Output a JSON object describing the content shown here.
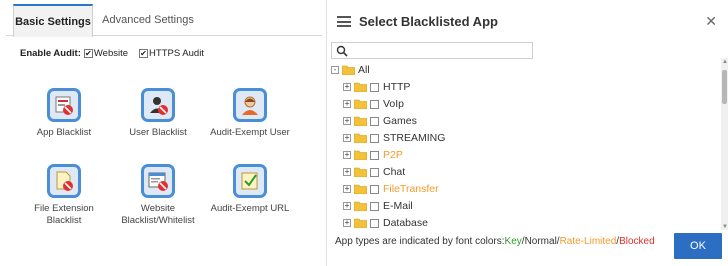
{
  "tabs": {
    "basic": "Basic Settings",
    "advanced": "Advanced Settings"
  },
  "audit": {
    "label": "Enable Audit:",
    "website": {
      "label": "Website",
      "checked": true
    },
    "https": {
      "label": "HTTPS Audit",
      "checked": true
    }
  },
  "tiles": [
    {
      "label": "App Blacklist",
      "icon": "app-blacklist-icon"
    },
    {
      "label": "User Blacklist",
      "icon": "user-blacklist-icon"
    },
    {
      "label": "Audit-Exempt User",
      "icon": "audit-exempt-user-icon"
    },
    {
      "label": "File Extension Blacklist",
      "icon": "file-extension-blacklist-icon"
    },
    {
      "label": "Website Blacklist/Whitelist",
      "icon": "website-list-icon"
    },
    {
      "label": "Audit-Exempt URL",
      "icon": "audit-exempt-url-icon"
    }
  ],
  "dialog": {
    "title": "Select Blacklisted App",
    "close": "✕",
    "ok_label": "OK"
  },
  "tree": {
    "root": {
      "label": "All",
      "expander": "-"
    },
    "items": [
      {
        "label": "HTTP",
        "type": "normal",
        "expander": "+"
      },
      {
        "label": "VoIp",
        "type": "normal",
        "expander": "+"
      },
      {
        "label": "Games",
        "type": "normal",
        "expander": "+"
      },
      {
        "label": "STREAMING",
        "type": "normal",
        "expander": "+"
      },
      {
        "label": "P2P",
        "type": "rate-limited",
        "expander": "+"
      },
      {
        "label": "Chat",
        "type": "normal",
        "expander": "+"
      },
      {
        "label": "FileTransfer",
        "type": "rate-limited",
        "expander": "+"
      },
      {
        "label": "E-Mail",
        "type": "normal",
        "expander": "+"
      },
      {
        "label": "Database",
        "type": "normal",
        "expander": "+"
      }
    ]
  },
  "legend": {
    "prefix": "App types are indicated by font colors:",
    "key": "Key",
    "sep1": "/",
    "normal": "Normal",
    "sep2": "/",
    "rate_limited": "Rate-Limited",
    "sep3": "/",
    "blocked": "Blocked"
  },
  "colors": {
    "accent": "#2c6fc2",
    "key": "#2a9d2a",
    "rate_limited": "#f39a2b",
    "blocked": "#e0302b",
    "folder": "#f3c23a"
  }
}
